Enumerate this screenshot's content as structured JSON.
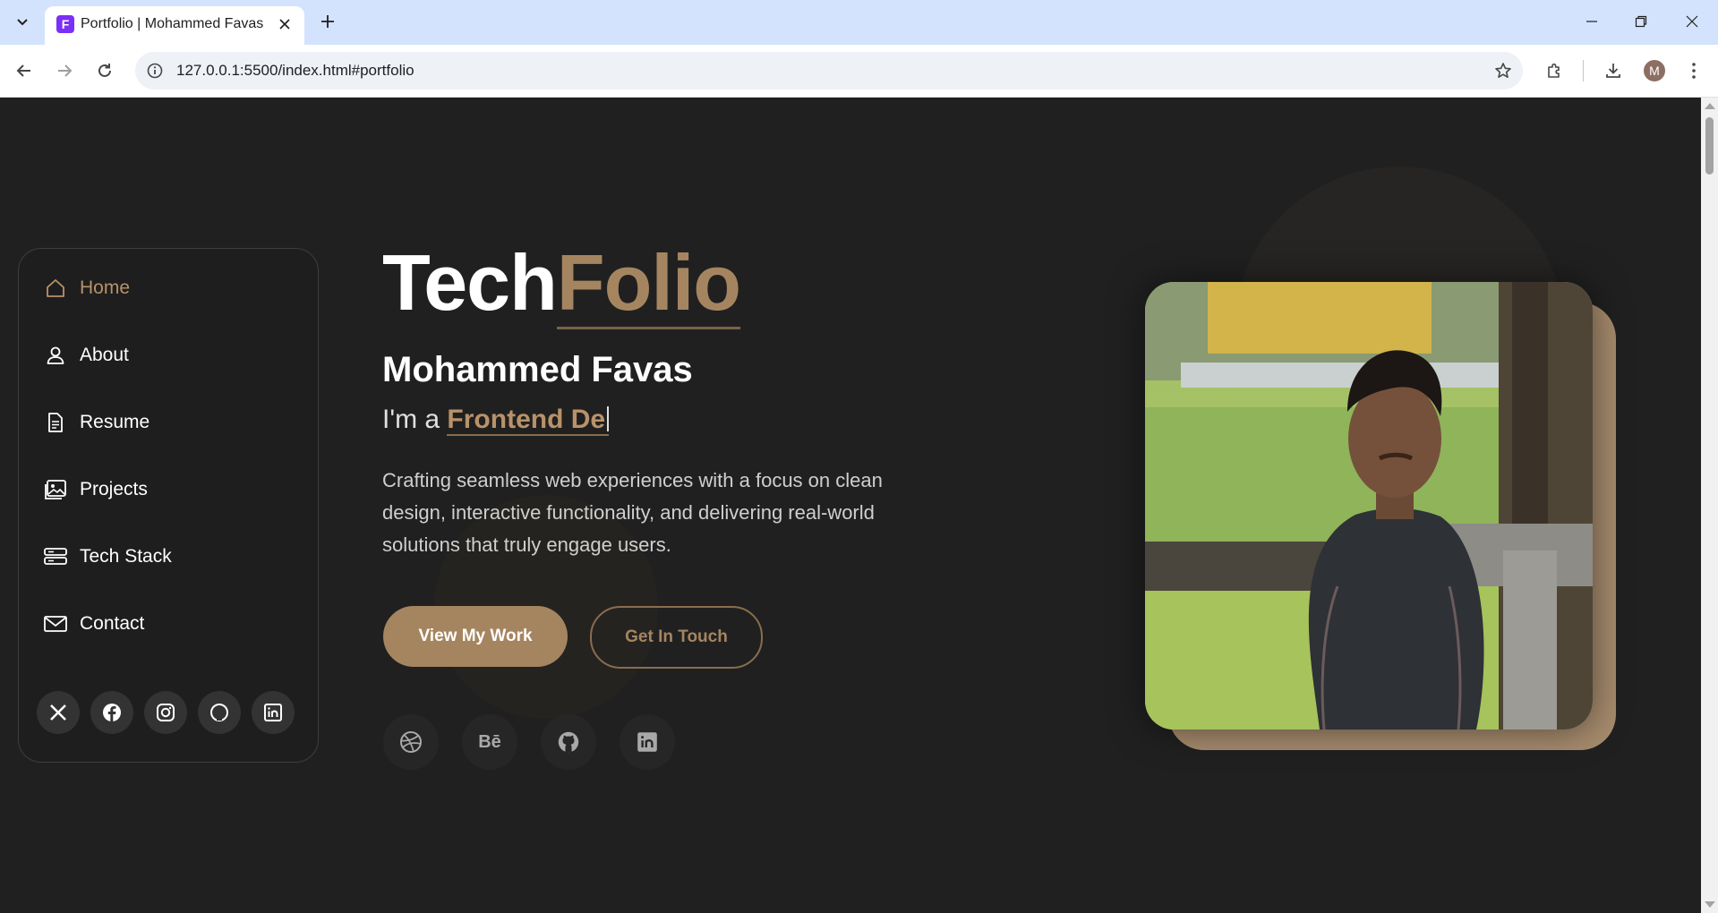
{
  "browser": {
    "tab_title": "Portfolio | Mohammed Favas",
    "favicon_letter": "F",
    "url": "127.0.0.1:5500/index.html#portfolio",
    "profile_initial": "M"
  },
  "sidebar": {
    "items": [
      {
        "label": "Home",
        "icon": "home-icon",
        "active": true
      },
      {
        "label": "About",
        "icon": "user-icon",
        "active": false
      },
      {
        "label": "Resume",
        "icon": "document-icon",
        "active": false
      },
      {
        "label": "Projects",
        "icon": "image-icon",
        "active": false
      },
      {
        "label": "Tech Stack",
        "icon": "server-icon",
        "active": false
      },
      {
        "label": "Contact",
        "icon": "envelope-icon",
        "active": false
      }
    ],
    "socials": [
      "x-icon",
      "facebook-icon",
      "instagram-icon",
      "github-icon",
      "linkedin-icon"
    ]
  },
  "hero": {
    "brand_part1": "Tech",
    "brand_part2": "Folio",
    "name": "Mohammed Favas",
    "role_prefix": "I'm a ",
    "role_typed": "Frontend De",
    "description": "Crafting seamless web experiences with a focus on clean design, interactive functionality, and delivering real-world solutions that truly engage users.",
    "primary_button": "View My Work",
    "secondary_button": "Get In Touch",
    "icon_links": [
      "dribbble-icon",
      "behance-icon",
      "github-icon",
      "linkedin-icon"
    ],
    "behance_glyph": "Bē"
  },
  "colors": {
    "accent": "#a58560",
    "background": "#202020",
    "photo_frame": "#a68b6d"
  }
}
